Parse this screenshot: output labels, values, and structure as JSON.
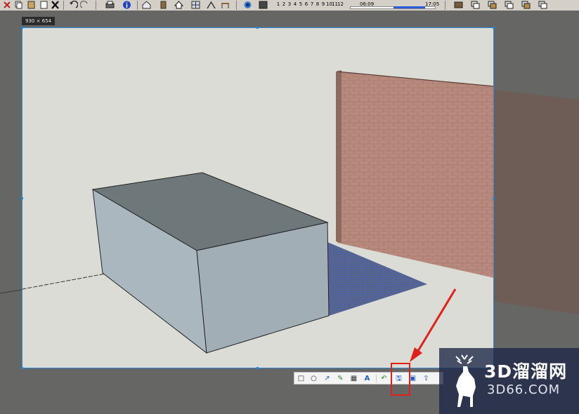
{
  "toolbar": {
    "months": [
      "1",
      "2",
      "3",
      "4",
      "5",
      "6",
      "7",
      "8",
      "9",
      "10",
      "11",
      "12"
    ],
    "time_start": "06:09",
    "time_end": "17:05"
  },
  "capture": {
    "size_label": "930 × 654"
  },
  "snip_toolbar": {
    "tools": [
      {
        "name": "rectangle-icon",
        "glyph": "□"
      },
      {
        "name": "ellipse-icon",
        "glyph": "○"
      },
      {
        "name": "arrow-icon",
        "glyph": "↗"
      },
      {
        "name": "pen-icon",
        "glyph": "✎"
      },
      {
        "name": "mosaic-icon",
        "glyph": "▦"
      },
      {
        "name": "text-icon",
        "glyph": "A"
      },
      {
        "name": "undo-icon",
        "glyph": "↶"
      },
      {
        "name": "save-icon",
        "glyph": "🖫"
      },
      {
        "name": "copy-icon",
        "glyph": "▣"
      },
      {
        "name": "share-icon",
        "glyph": "⇪"
      }
    ]
  },
  "watermark": {
    "brand": "3D溜溜网",
    "domain": "3D66.COM"
  },
  "colors": {
    "accent_red": "#e0211b",
    "selection_blue": "#2e8ad8"
  }
}
